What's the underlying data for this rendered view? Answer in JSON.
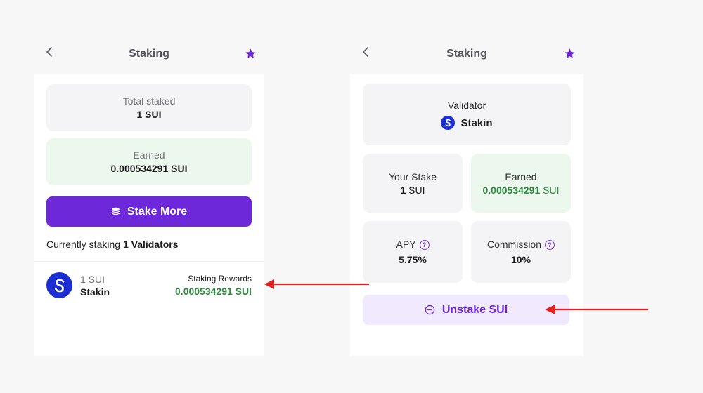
{
  "left": {
    "header": {
      "title": "Staking",
      "back_icon": "chevron-left-icon",
      "star_icon": "star-icon"
    },
    "total_staked": {
      "label": "Total staked",
      "value": "1 SUI"
    },
    "earned": {
      "label": "Earned",
      "value": "0.000534291 SUI"
    },
    "stake_more_button": {
      "label": "Stake More",
      "icon": "coins-stack-icon"
    },
    "currently": {
      "prefix": "Currently staking ",
      "count_text": "1 Validators"
    },
    "validator": {
      "amount": "1 SUI",
      "name": "Stakin",
      "rewards_label": "Staking Rewards",
      "rewards_value": "0.000534291 SUI"
    }
  },
  "right": {
    "header": {
      "title": "Staking",
      "back_icon": "chevron-left-icon",
      "star_icon": "star-icon"
    },
    "validator": {
      "label": "Validator",
      "name": "Stakin"
    },
    "your_stake": {
      "label": "Your Stake",
      "amount": "1",
      "unit": "SUI"
    },
    "earned": {
      "label": "Earned",
      "amount": "0.000534291",
      "unit": "SUI"
    },
    "apy": {
      "label": "APY",
      "value": "5.75%"
    },
    "commission": {
      "label": "Commission",
      "value": "10%"
    },
    "unstake_button": {
      "label": "Unstake SUI",
      "icon": "minus-circle-icon"
    }
  },
  "colors": {
    "accent": "#6d28d9",
    "star": "#6d28d9",
    "green": "#2e8b3d",
    "arrow": "#e61e1e",
    "validator_logo": "#1c2fd3"
  }
}
